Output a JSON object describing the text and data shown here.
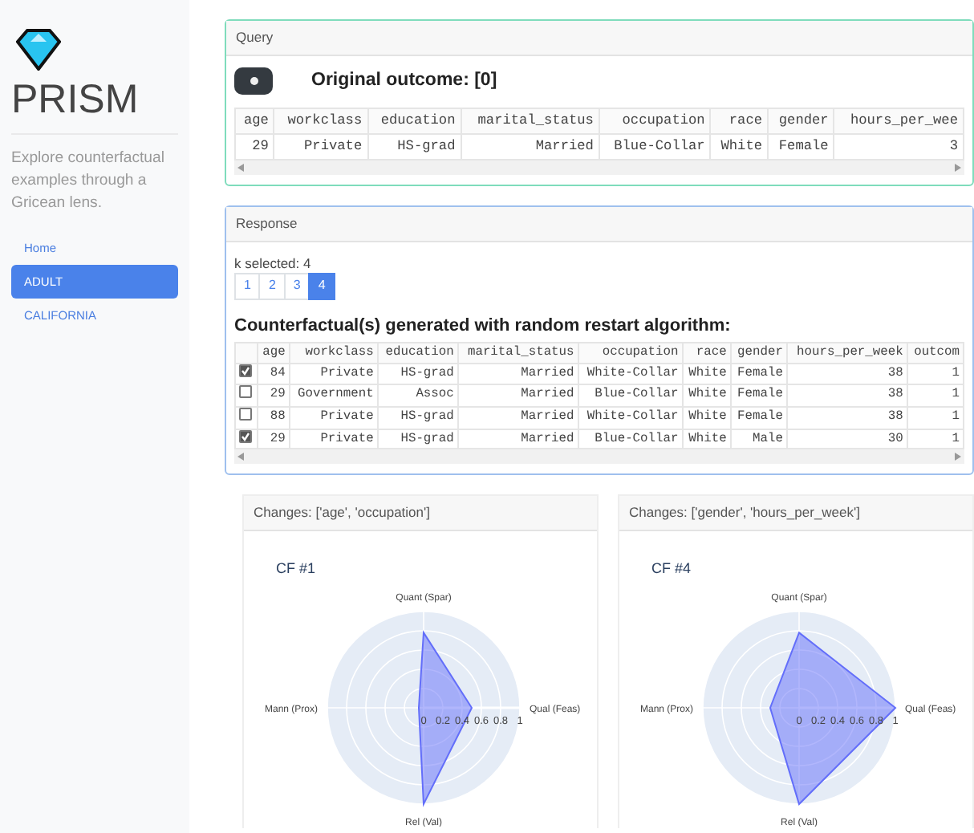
{
  "sidebar": {
    "title": "PRISM",
    "description": "Explore counterfactual examples through a Gricean lens.",
    "items": [
      {
        "label": "Home",
        "selected": false
      },
      {
        "label": "ADULT",
        "selected": true
      },
      {
        "label": "CALIFORNIA",
        "selected": false
      }
    ]
  },
  "query": {
    "header": "Query",
    "outcome": "Original outcome: [0]",
    "columns": [
      "age",
      "workclass",
      "education",
      "marital_status",
      "occupation",
      "race",
      "gender",
      "hours_per_wee"
    ],
    "rows": [
      [
        "29",
        "Private",
        "HS-grad",
        "Married",
        "Blue-Collar",
        "White",
        "Female",
        "3"
      ]
    ]
  },
  "response": {
    "header": "Response",
    "k_label": "k selected: 4",
    "pages": [
      {
        "label": "1",
        "selected": false
      },
      {
        "label": "2",
        "selected": false
      },
      {
        "label": "3",
        "selected": false
      },
      {
        "label": "4",
        "selected": true
      }
    ],
    "heading": "Counterfactual(s) generated with random restart algorithm:",
    "columns": [
      "age",
      "workclass",
      "education",
      "marital_status",
      "occupation",
      "race",
      "gender",
      "hours_per_week",
      "outcom"
    ],
    "rows": [
      {
        "checked": true,
        "cells": [
          "84",
          "Private",
          "HS-grad",
          "Married",
          "White-Collar",
          "White",
          "Female",
          "38",
          "1"
        ]
      },
      {
        "checked": false,
        "cells": [
          "29",
          "Government",
          "Assoc",
          "Married",
          "Blue-Collar",
          "White",
          "Female",
          "38",
          "1"
        ]
      },
      {
        "checked": false,
        "cells": [
          "88",
          "Private",
          "HS-grad",
          "Married",
          "White-Collar",
          "White",
          "Female",
          "38",
          "1"
        ]
      },
      {
        "checked": true,
        "cells": [
          "29",
          "Private",
          "HS-grad",
          "Married",
          "Blue-Collar",
          "White",
          "Male",
          "30",
          "1"
        ]
      }
    ]
  },
  "charts": [
    {
      "header": "Changes: ['age', 'occupation']",
      "radar": {
        "title": "CF #1",
        "tick_labels": [
          "0",
          "0.2",
          "0.4",
          "0.6",
          "0.8",
          "1"
        ],
        "axes": [
          {
            "label": "Quant (Spar)"
          },
          {
            "label": "Qual (Feas)"
          },
          {
            "label": "Rel (Val)"
          },
          {
            "label": "Mann (Prox)"
          }
        ]
      }
    },
    {
      "header": "Changes: ['gender', 'hours_per_week']",
      "radar": {
        "title": "CF #4",
        "tick_labels": [
          "0",
          "0.2",
          "0.4",
          "0.6",
          "0.8",
          "1"
        ],
        "axes": [
          {
            "label": "Quant (Spar)"
          },
          {
            "label": "Qual (Feas)"
          },
          {
            "label": "Rel (Val)"
          },
          {
            "label": "Mann (Prox)"
          }
        ]
      }
    }
  ]
}
